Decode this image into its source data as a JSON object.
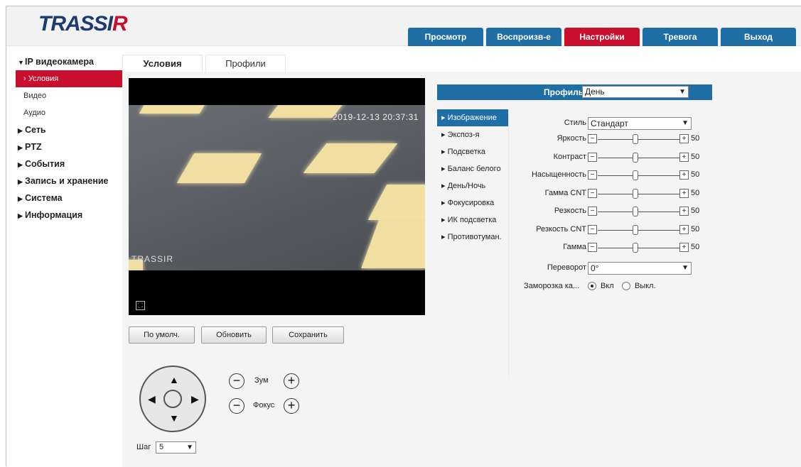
{
  "brand": {
    "logo_main": "TRASSI",
    "logo_accent": "R"
  },
  "topnav": {
    "items": [
      {
        "label": "Просмотр"
      },
      {
        "label": "Воспроизв-е"
      },
      {
        "label": "Настройки",
        "active": true
      },
      {
        "label": "Тревога"
      },
      {
        "label": "Выход"
      }
    ]
  },
  "sidebar": {
    "group_ip": "IP видеокамера",
    "sub_conditions": "Условия",
    "sub_video": "Видео",
    "sub_audio": "Аудио",
    "network": "Сеть",
    "ptz": "PTZ",
    "events": "События",
    "storage": "Запись и хранение",
    "system": "Система",
    "info": "Информация"
  },
  "tabs": {
    "conditions": "Условия",
    "profiles": "Профили"
  },
  "video": {
    "timestamp": "2019-12-13 20:37:31",
    "watermark": "TRASSIR"
  },
  "buttons": {
    "default": "По умолч.",
    "refresh": "Обновить",
    "save": "Сохранить"
  },
  "ptz": {
    "zoom": "Зум",
    "focus": "Фокус",
    "step_label": "Шаг",
    "step_value": "5",
    "minus": "−",
    "plus": "+"
  },
  "profile": {
    "label": "Профиль",
    "value": "День"
  },
  "submenu": [
    "Изображение",
    "Экспоз-я",
    "Подсветка",
    "Баланс белого",
    "День/Ночь",
    "Фокусировка",
    "ИК подсветка",
    "Противотуман."
  ],
  "image": {
    "style_label": "Стиль",
    "style_value": "Стандарт",
    "sliders": [
      {
        "label": "Яркость",
        "value": "50"
      },
      {
        "label": "Контраст",
        "value": "50"
      },
      {
        "label": "Насыщенность",
        "value": "50"
      },
      {
        "label": "Гамма CNT",
        "value": "50"
      },
      {
        "label": "Резкость",
        "value": "50"
      },
      {
        "label": "Резкость CNT",
        "value": "50"
      },
      {
        "label": "Гамма",
        "value": "50"
      }
    ],
    "flip_label": "Переворот",
    "flip_value": "0°",
    "freeze_label": "Заморозка ка...",
    "freeze_on": "Вкл",
    "freeze_off": "Выкл."
  },
  "colors": {
    "accent_red": "#c8102e",
    "accent_blue": "#1f6fa6"
  }
}
